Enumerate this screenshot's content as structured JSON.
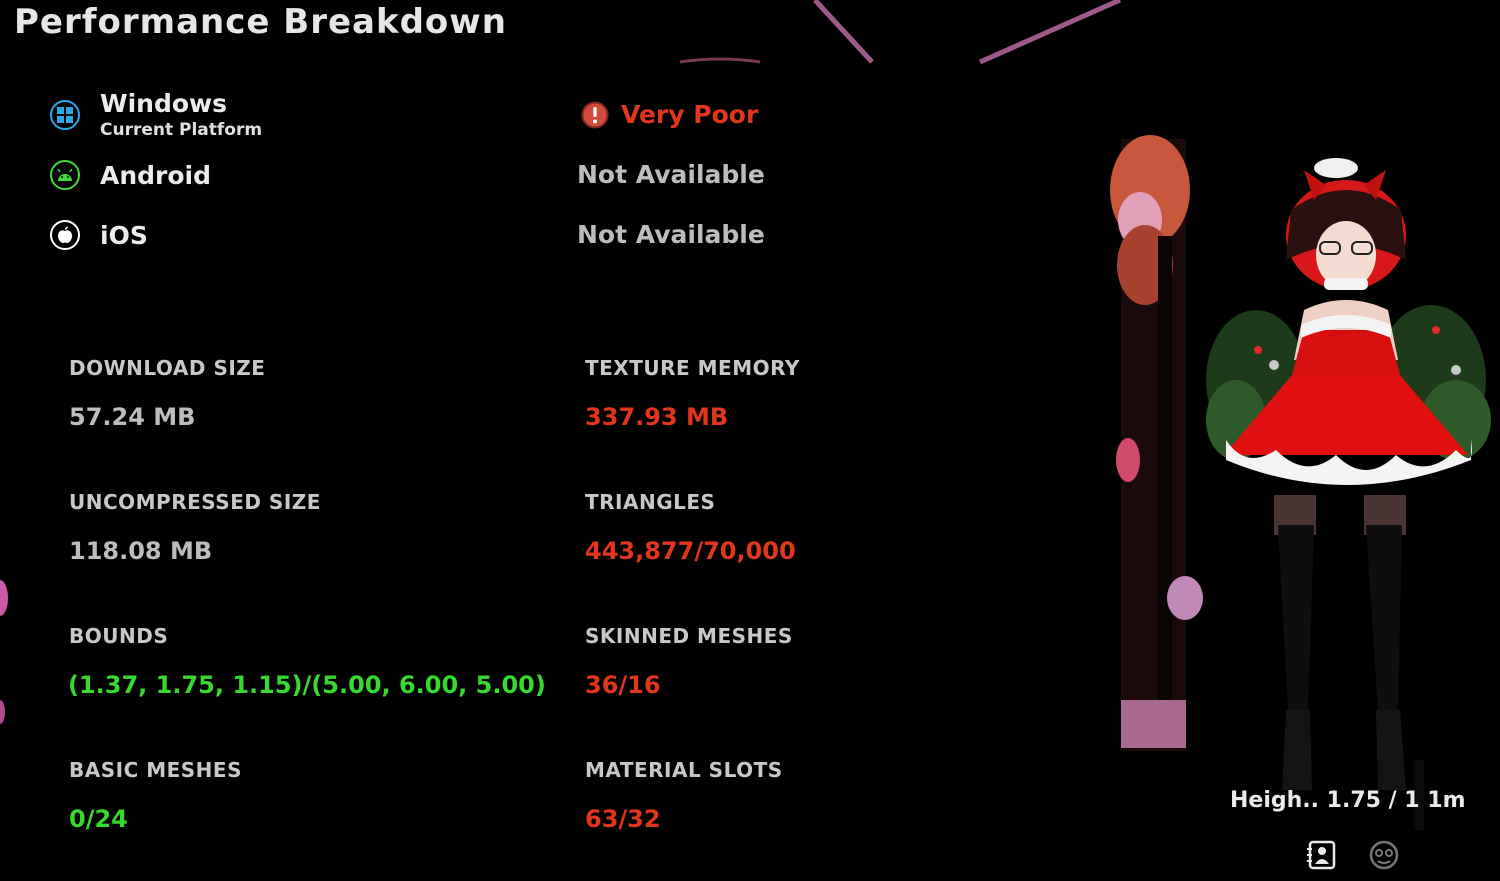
{
  "header": {
    "title": "Performance Breakdown"
  },
  "platforms": [
    {
      "name": "Windows",
      "subtitle": "Current Platform",
      "status": "Very Poor",
      "icon": "windows-icon",
      "status_icon": "warning-icon",
      "status_color": "#e2361c"
    },
    {
      "name": "Android",
      "subtitle": "",
      "status": "Not Available",
      "icon": "android-icon",
      "status_color": "#bdbdbd"
    },
    {
      "name": "iOS",
      "subtitle": "",
      "status": "Not Available",
      "icon": "apple-icon",
      "status_color": "#bdbdbd"
    }
  ],
  "stats": [
    {
      "label": "DOWNLOAD SIZE",
      "value": "57.24 MB",
      "status": "neutral"
    },
    {
      "label": "TEXTURE MEMORY",
      "value": "337.93 MB",
      "status": "bad"
    },
    {
      "label": "UNCOMPRESSED SIZE",
      "value": "118.08 MB",
      "status": "neutral"
    },
    {
      "label": "TRIANGLES",
      "value": "443,877/70,000",
      "status": "bad"
    },
    {
      "label": "BOUNDS",
      "value": "(1.37, 1.75, 1.15)/(5.00, 6.00, 5.00)",
      "status": "good"
    },
    {
      "label": "SKINNED MESHES",
      "value": "36/16",
      "status": "bad"
    },
    {
      "label": "BASIC MESHES",
      "value": "0/24",
      "status": "good"
    },
    {
      "label": "MATERIAL SLOTS",
      "value": "63/32",
      "status": "bad"
    }
  ],
  "colors": {
    "bad": "#e2361c",
    "good": "#38d92e",
    "neutral": "#bdbdbd",
    "windows": "#2aa7e8",
    "android": "#3ddc3d"
  },
  "avatar": {
    "height_text": "Heigh.. 1.75 / 1   1m"
  },
  "bottom_icons": [
    "id-card-icon",
    "avatar-face-icon"
  ]
}
